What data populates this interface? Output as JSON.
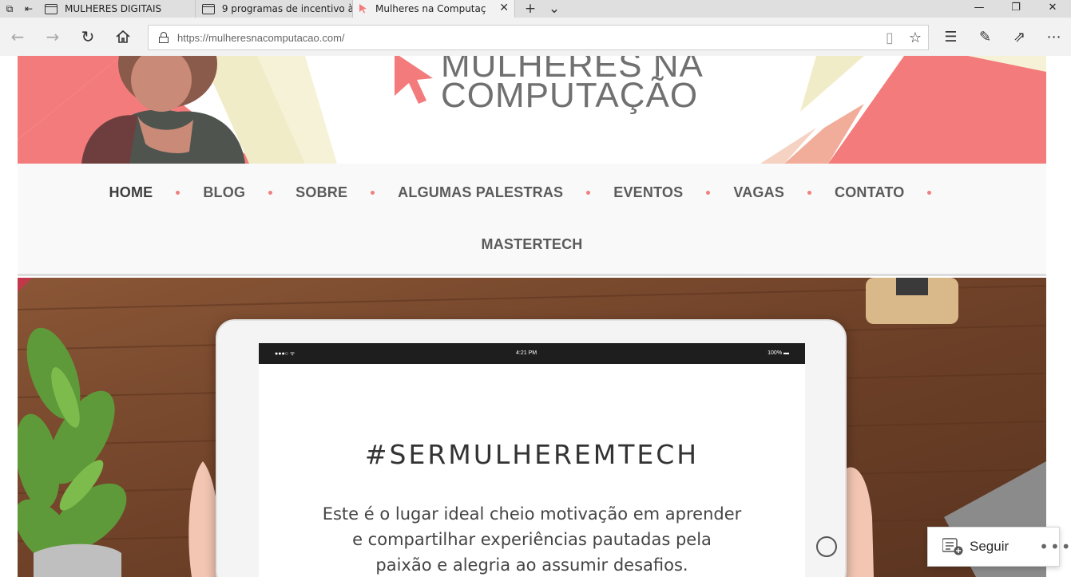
{
  "browser": {
    "tabs": [
      {
        "title": "MULHERES DIGITAIS",
        "active": false
      },
      {
        "title": "9 programas de incentivo à",
        "active": false
      },
      {
        "title": "Mulheres na Computaç",
        "active": true
      }
    ],
    "url": "https://mulheresnacomputacao.com/",
    "icons": {
      "back": "back-arrow-icon",
      "forward": "forward-arrow-icon",
      "refresh": "refresh-icon",
      "home": "home-icon",
      "lock": "lock-icon",
      "reading_view": "book-icon",
      "favorite": "star-icon",
      "favorites_hub": "favorites-list-icon",
      "notes": "pen-icon",
      "share": "share-icon",
      "more": "more-icon"
    }
  },
  "site": {
    "brand_line1": "MULHERES NA",
    "brand_line2": "COMPUTAÇÃO",
    "menu_row1": [
      "HOME",
      "BLOG",
      "SOBRE",
      "ALGUMAS PALESTRAS",
      "EVENTOS",
      "VAGAS",
      "CONTATO"
    ],
    "menu_row2": [
      "MASTERTECH"
    ],
    "hero": {
      "status_time": "4:21 PM",
      "status_battery": "100%",
      "title": "#SERMULHEREMTECH",
      "text_line1": "Este é o lugar ideal cheio motivação em aprender",
      "text_line2": "e compartilhar experiências pautadas pela",
      "text_line3": "paixão e alegria ao assumir desafios."
    },
    "follow": {
      "label": "Seguir",
      "more": "•••"
    }
  },
  "colors": {
    "accent_pink": "#f47b7b",
    "menu_dot": "#f08080",
    "wood": "#7a4a2e"
  }
}
